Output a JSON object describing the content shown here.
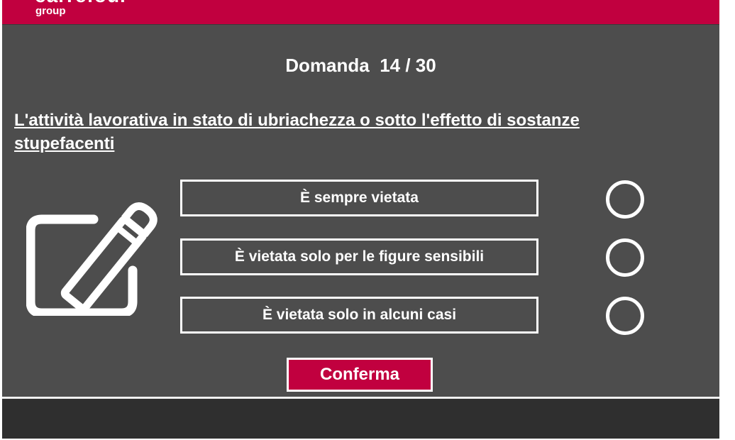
{
  "header": {
    "logo_text": "carrefour",
    "logo_subtext": "group",
    "accent_color": "#c1003f"
  },
  "quiz": {
    "counter_label": "Domanda  14 / 30",
    "question": "L'attività lavorativa in stato di ubriachezza o sotto l'effetto di sostanze stupefacenti",
    "answers": [
      {
        "label": "È sempre vietata",
        "selected": false
      },
      {
        "label": "È vietata solo per le figure sensibili",
        "selected": false
      },
      {
        "label": "È vietata solo in alcuni casi",
        "selected": false
      }
    ],
    "confirm_label": "Conferma",
    "illustration_icon": "edit-pencil-icon"
  }
}
